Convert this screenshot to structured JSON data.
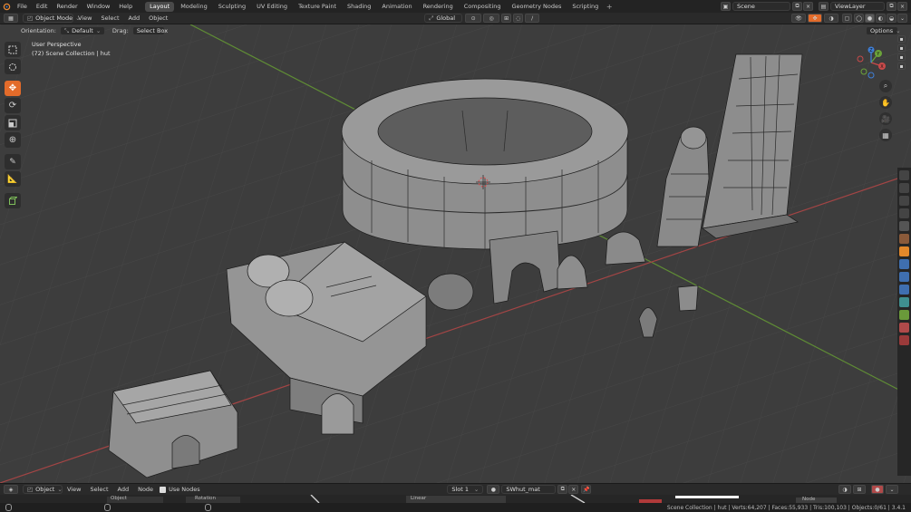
{
  "menu": [
    "File",
    "Edit",
    "Render",
    "Window",
    "Help"
  ],
  "workspaces": [
    "Layout",
    "Modeling",
    "Sculpting",
    "UV Editing",
    "Texture Paint",
    "Shading",
    "Animation",
    "Rendering",
    "Compositing",
    "Geometry Nodes",
    "Scripting"
  ],
  "active_workspace": "Layout",
  "scene_name": "Scene",
  "view_layer": "ViewLayer",
  "header": {
    "mode": "Object Mode",
    "menus": [
      "View",
      "Select",
      "Add",
      "Object"
    ],
    "transform": "Global",
    "options": "Options"
  },
  "tool_settings": {
    "orientation_label": "Orientation:",
    "orientation_value": "Default",
    "drag_label": "Drag:",
    "drag_value": "Select Box"
  },
  "overlay": {
    "perspective": "User Perspective",
    "collection": "(72) Scene Collection | hut"
  },
  "gizmo": {
    "axes": [
      "X",
      "Y",
      "Z"
    ]
  },
  "node_header": {
    "editor_mode": "Object",
    "menus": [
      "View",
      "Select",
      "Add",
      "Node"
    ],
    "use_nodes": "Use Nodes",
    "slot": "Slot 1",
    "material": "SWhut_mat"
  },
  "node_fragments": [
    "Rotation",
    "Linear",
    "Object",
    "Node"
  ],
  "status": {
    "text": "Scene Collection | hut | Verts:64,207 | Faces:55,933 | Tris:100,103 | Objects:0/61 | 3.4.1"
  },
  "colors": {
    "accent": "#e36b2a",
    "axis_x": "#c84a4a",
    "axis_y": "#6ba33a",
    "axis_z": "#3f7fd6",
    "viewport_bg": "#3d3d3d"
  }
}
